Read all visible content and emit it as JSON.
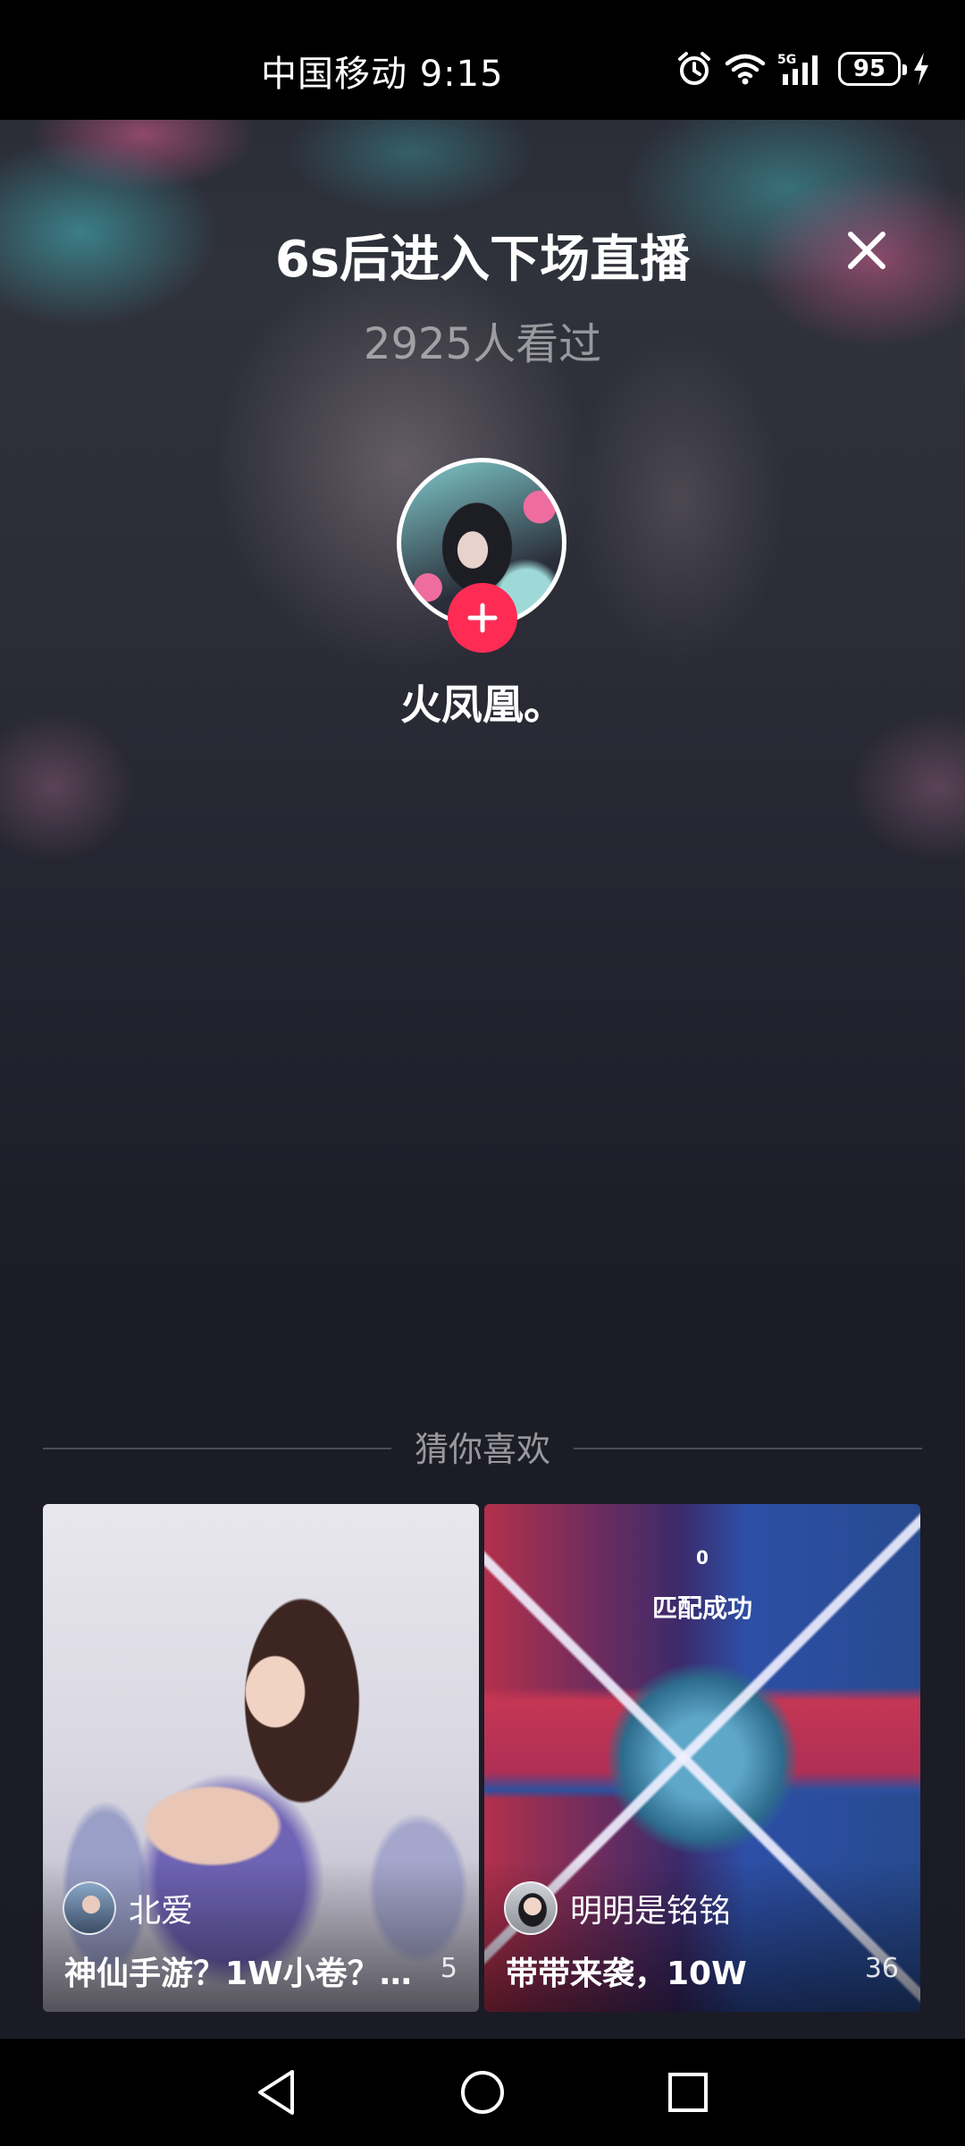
{
  "status_bar": {
    "carrier_time": "中国移动 9:15",
    "battery": "95",
    "icons": [
      "alarm-icon",
      "wifi-icon",
      "signal-5g-icon",
      "battery-icon",
      "charging-icon"
    ]
  },
  "header": {
    "countdown_title": "6s后进入下场直播",
    "viewer_count": "2925人看过"
  },
  "streamer": {
    "name": "火凤凰。"
  },
  "recommend": {
    "title": "猜你喜欢",
    "cards": [
      {
        "username": "北爱",
        "title": "神仙手游？1W小卷？…",
        "count": "5"
      },
      {
        "username": "明明是铭铭",
        "title": "带带来袭，10W",
        "count": "36",
        "overlay_text": "匹配成功",
        "overlay_number": "0"
      }
    ]
  },
  "colors": {
    "accent": "#fe2c55",
    "background": "#1a1b25"
  }
}
